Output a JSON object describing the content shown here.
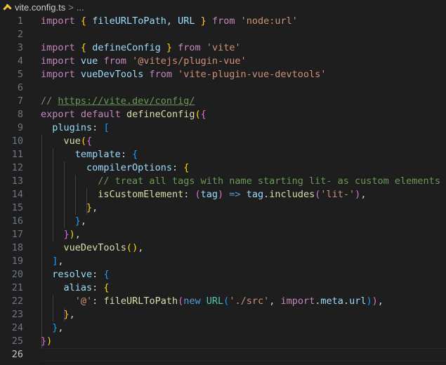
{
  "breadcrumb": {
    "file_name": "vite.config.ts",
    "separator": ">",
    "ellipsis": "...",
    "file_icon": "typescript-config-icon"
  },
  "editor": {
    "active_line": 26,
    "lines": [
      {
        "n": "1",
        "tokens": [
          [
            "keyword",
            "import"
          ],
          [
            "punc",
            " "
          ],
          [
            "b1",
            "{"
          ],
          [
            "punc",
            " "
          ],
          [
            "var",
            "fileURLToPath"
          ],
          [
            "punc",
            ", "
          ],
          [
            "var",
            "URL"
          ],
          [
            "punc",
            " "
          ],
          [
            "b1",
            "}"
          ],
          [
            "punc",
            " "
          ],
          [
            "keyword",
            "from"
          ],
          [
            "punc",
            " "
          ],
          [
            "string",
            "'node:url'"
          ]
        ]
      },
      {
        "n": "2",
        "tokens": []
      },
      {
        "n": "3",
        "tokens": [
          [
            "keyword",
            "import"
          ],
          [
            "punc",
            " "
          ],
          [
            "b1",
            "{"
          ],
          [
            "punc",
            " "
          ],
          [
            "var",
            "defineConfig"
          ],
          [
            "punc",
            " "
          ],
          [
            "b1",
            "}"
          ],
          [
            "punc",
            " "
          ],
          [
            "keyword",
            "from"
          ],
          [
            "punc",
            " "
          ],
          [
            "string",
            "'vite'"
          ]
        ]
      },
      {
        "n": "4",
        "tokens": [
          [
            "keyword",
            "import"
          ],
          [
            "punc",
            " "
          ],
          [
            "var",
            "vue"
          ],
          [
            "punc",
            " "
          ],
          [
            "keyword",
            "from"
          ],
          [
            "punc",
            " "
          ],
          [
            "string",
            "'@vitejs/plugin-vue'"
          ]
        ]
      },
      {
        "n": "5",
        "tokens": [
          [
            "keyword",
            "import"
          ],
          [
            "punc",
            " "
          ],
          [
            "var",
            "vueDevTools"
          ],
          [
            "punc",
            " "
          ],
          [
            "keyword",
            "from"
          ],
          [
            "punc",
            " "
          ],
          [
            "string",
            "'vite-plugin-vue-devtools'"
          ]
        ]
      },
      {
        "n": "6",
        "tokens": []
      },
      {
        "n": "7",
        "tokens": [
          [
            "comment",
            "// "
          ],
          [
            "link",
            "https://vite.dev/config/"
          ]
        ]
      },
      {
        "n": "8",
        "tokens": [
          [
            "keyword",
            "export"
          ],
          [
            "punc",
            " "
          ],
          [
            "keyword",
            "default"
          ],
          [
            "punc",
            " "
          ],
          [
            "func",
            "defineConfig"
          ],
          [
            "b1",
            "("
          ],
          [
            "b2",
            "{"
          ]
        ]
      },
      {
        "n": "9",
        "tokens": [
          [
            "punc",
            "  "
          ],
          [
            "var",
            "plugins"
          ],
          [
            "punc",
            ": "
          ],
          [
            "b3",
            "["
          ]
        ]
      },
      {
        "n": "10",
        "tokens": [
          [
            "punc",
            "    "
          ],
          [
            "func",
            "vue"
          ],
          [
            "b1",
            "("
          ],
          [
            "b2",
            "{"
          ]
        ]
      },
      {
        "n": "11",
        "tokens": [
          [
            "punc",
            "      "
          ],
          [
            "var",
            "template"
          ],
          [
            "punc",
            ": "
          ],
          [
            "b3",
            "{"
          ]
        ]
      },
      {
        "n": "12",
        "tokens": [
          [
            "punc",
            "        "
          ],
          [
            "var",
            "compilerOptions"
          ],
          [
            "punc",
            ": "
          ],
          [
            "b1",
            "{"
          ]
        ]
      },
      {
        "n": "13",
        "tokens": [
          [
            "punc",
            "          "
          ],
          [
            "comment",
            "// treat all tags with name starting lit- as custom elements"
          ]
        ]
      },
      {
        "n": "14",
        "tokens": [
          [
            "punc",
            "          "
          ],
          [
            "func",
            "isCustomElement"
          ],
          [
            "punc",
            ": "
          ],
          [
            "b2",
            "("
          ],
          [
            "var",
            "tag"
          ],
          [
            "b2",
            ")"
          ],
          [
            "punc",
            " "
          ],
          [
            "storage",
            "=>"
          ],
          [
            "punc",
            " "
          ],
          [
            "var",
            "tag"
          ],
          [
            "punc",
            "."
          ],
          [
            "func",
            "includes"
          ],
          [
            "b2",
            "("
          ],
          [
            "string",
            "'lit-'"
          ],
          [
            "b2",
            ")"
          ],
          [
            "punc",
            ","
          ]
        ]
      },
      {
        "n": "15",
        "tokens": [
          [
            "punc",
            "        "
          ],
          [
            "b1",
            "}"
          ],
          [
            "punc",
            ","
          ]
        ]
      },
      {
        "n": "16",
        "tokens": [
          [
            "punc",
            "      "
          ],
          [
            "b3",
            "}"
          ],
          [
            "punc",
            ","
          ]
        ]
      },
      {
        "n": "17",
        "tokens": [
          [
            "punc",
            "    "
          ],
          [
            "b2",
            "}"
          ],
          [
            "b1",
            ")"
          ],
          [
            "punc",
            ","
          ]
        ]
      },
      {
        "n": "18",
        "tokens": [
          [
            "punc",
            "    "
          ],
          [
            "func",
            "vueDevTools"
          ],
          [
            "b1",
            "("
          ],
          [
            "b1",
            ")"
          ],
          [
            "punc",
            ","
          ]
        ]
      },
      {
        "n": "19",
        "tokens": [
          [
            "punc",
            "  "
          ],
          [
            "b3",
            "]"
          ],
          [
            "punc",
            ","
          ]
        ]
      },
      {
        "n": "20",
        "tokens": [
          [
            "punc",
            "  "
          ],
          [
            "var",
            "resolve"
          ],
          [
            "punc",
            ": "
          ],
          [
            "b3",
            "{"
          ]
        ]
      },
      {
        "n": "21",
        "tokens": [
          [
            "punc",
            "    "
          ],
          [
            "var",
            "alias"
          ],
          [
            "punc",
            ": "
          ],
          [
            "b1",
            "{"
          ]
        ]
      },
      {
        "n": "22",
        "tokens": [
          [
            "punc",
            "      "
          ],
          [
            "string",
            "'@'"
          ],
          [
            "punc",
            ": "
          ],
          [
            "func",
            "fileURLToPath"
          ],
          [
            "b2",
            "("
          ],
          [
            "storage",
            "new"
          ],
          [
            "punc",
            " "
          ],
          [
            "type",
            "URL"
          ],
          [
            "b3",
            "("
          ],
          [
            "string",
            "'./src'"
          ],
          [
            "punc",
            ", "
          ],
          [
            "keyword",
            "import"
          ],
          [
            "punc",
            "."
          ],
          [
            "var",
            "meta"
          ],
          [
            "punc",
            "."
          ],
          [
            "var",
            "url"
          ],
          [
            "b3",
            ")"
          ],
          [
            "b2",
            ")"
          ],
          [
            "punc",
            ","
          ]
        ]
      },
      {
        "n": "23",
        "tokens": [
          [
            "punc",
            "    "
          ],
          [
            "b1",
            "}"
          ],
          [
            "punc",
            ","
          ]
        ]
      },
      {
        "n": "24",
        "tokens": [
          [
            "punc",
            "  "
          ],
          [
            "b3",
            "}"
          ],
          [
            "punc",
            ","
          ]
        ]
      },
      {
        "n": "25",
        "tokens": [
          [
            "b2",
            "}"
          ],
          [
            "b1",
            ")"
          ]
        ]
      },
      {
        "n": "26",
        "tokens": []
      }
    ]
  }
}
